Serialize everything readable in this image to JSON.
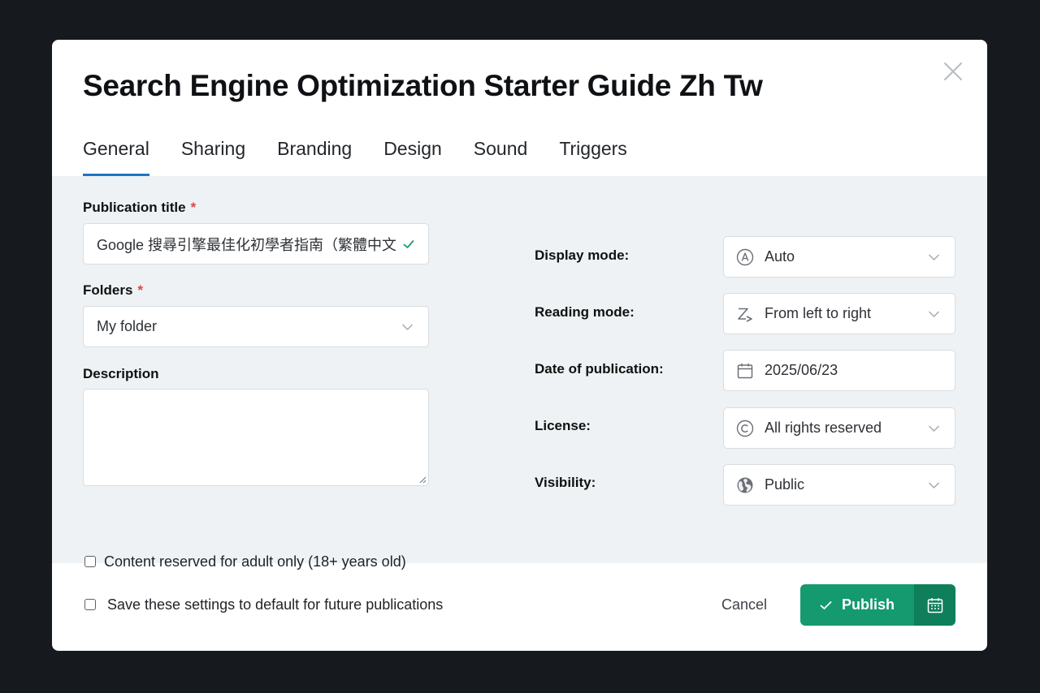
{
  "dialog": {
    "title": "Search Engine Optimization Starter Guide Zh Tw"
  },
  "tabs": [
    {
      "label": "General",
      "active": true
    },
    {
      "label": "Sharing",
      "active": false
    },
    {
      "label": "Branding",
      "active": false
    },
    {
      "label": "Design",
      "active": false
    },
    {
      "label": "Sound",
      "active": false
    },
    {
      "label": "Triggers",
      "active": false
    }
  ],
  "general": {
    "publication_title": {
      "label": "Publication title",
      "required_marker": "*",
      "value": "Google 搜尋引擎最佳化初學者指南（繁體中文"
    },
    "folders": {
      "label": "Folders",
      "required_marker": "*",
      "value": "My folder"
    },
    "description": {
      "label": "Description",
      "value": ""
    },
    "adult_only": {
      "label": "Content reserved for adult only (18+ years old)",
      "checked": false
    },
    "display_mode": {
      "label": "Display mode:",
      "value": "Auto",
      "icon": "auto-mode-icon"
    },
    "reading_mode": {
      "label": "Reading mode:",
      "value": "From left to right",
      "icon": "reading-direction-icon"
    },
    "date_of_publication": {
      "label": "Date of publication:",
      "value": "2025/06/23",
      "icon": "calendar-icon"
    },
    "license": {
      "label": "License:",
      "value": "All rights reserved",
      "icon": "copyright-icon"
    },
    "visibility": {
      "label": "Visibility:",
      "value": "Public",
      "icon": "globe-icon"
    }
  },
  "footer": {
    "save_default": {
      "label": "Save these settings to default for future publications",
      "checked": false
    },
    "cancel_label": "Cancel",
    "publish_label": "Publish"
  },
  "colors": {
    "accent_tab": "#1d74c6",
    "publish": "#149a6e",
    "publish_dark": "#0e7f5a",
    "required": "#e0434b"
  }
}
